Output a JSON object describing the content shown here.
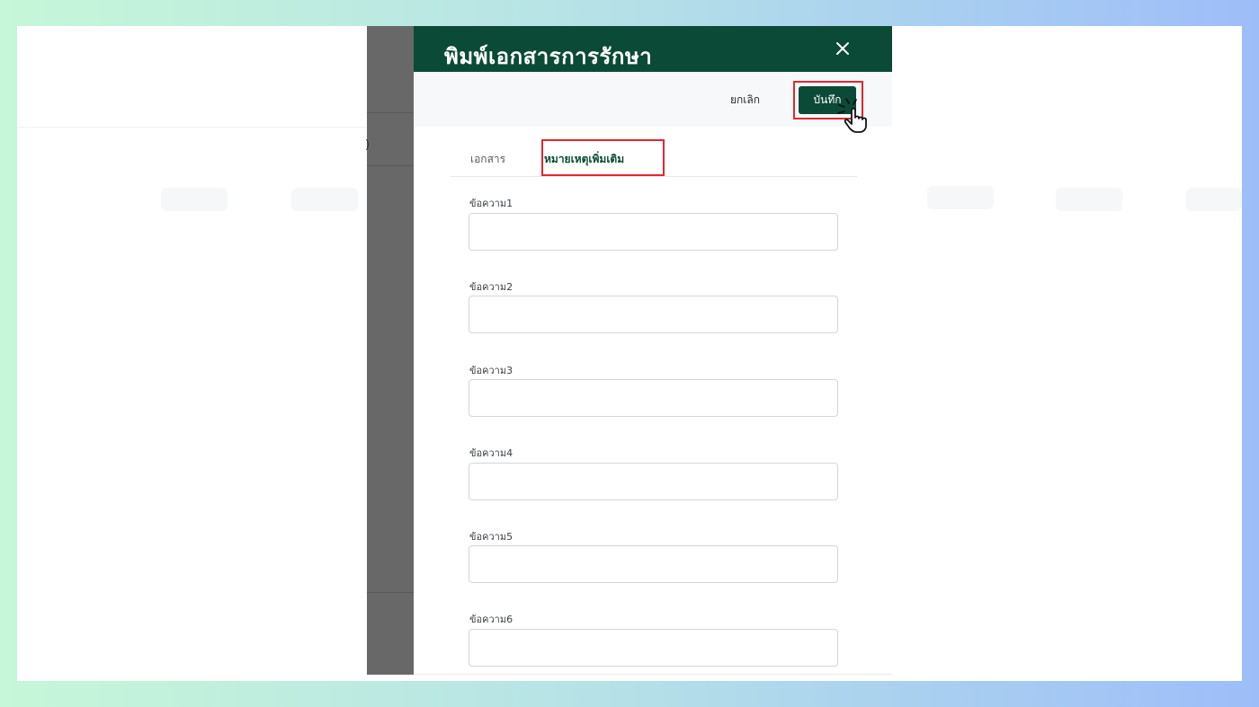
{
  "dialog": {
    "title": "พิมพ์เอกสารการรักษา",
    "close_icon": "close-icon",
    "cancel_label": "ยกเลิก",
    "save_label": "บันทึก"
  },
  "tabs": [
    {
      "label": "เอกสาร",
      "active": false
    },
    {
      "label": "หมายเหตุเพิ่มเติม",
      "active": true
    }
  ],
  "fields": [
    {
      "label": "ข้อความ1",
      "value": ""
    },
    {
      "label": "ข้อความ2",
      "value": ""
    },
    {
      "label": "ข้อความ3",
      "value": ""
    },
    {
      "label": "ข้อความ4",
      "value": ""
    },
    {
      "label": "ข้อความ5",
      "value": ""
    },
    {
      "label": "ข้อความ6",
      "value": ""
    }
  ],
  "background": {
    "overlay_char": ")"
  },
  "colors": {
    "primary": "#0b4a36",
    "highlight": "#e4262f",
    "overlay": "#686868"
  },
  "annotation": {
    "cursor_icon": "hand-pointer-icon"
  }
}
